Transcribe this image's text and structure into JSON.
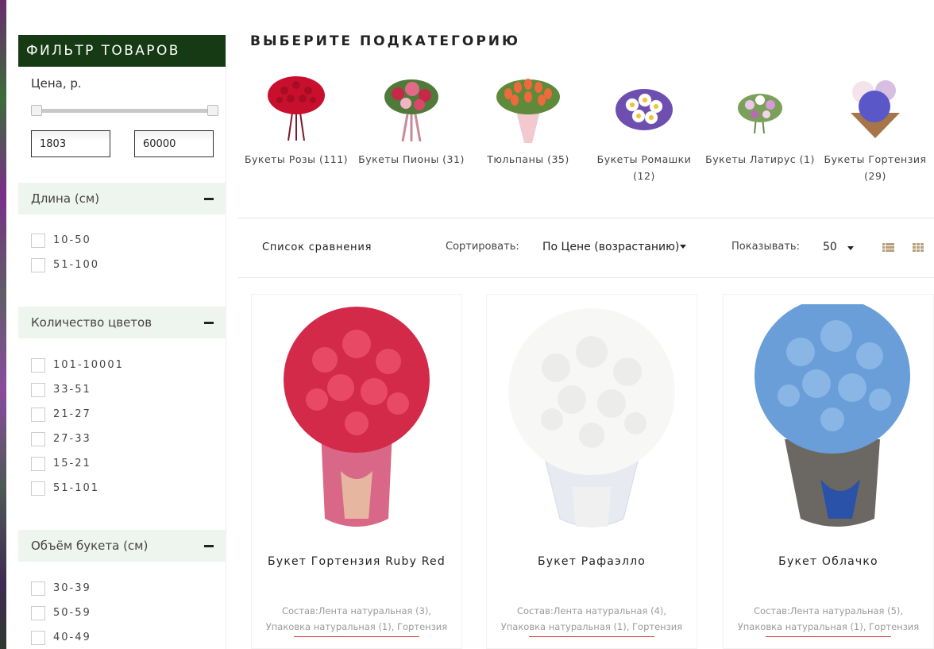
{
  "sidebar": {
    "title": "ФИЛЬТР ТОВАРОВ",
    "price": {
      "label": "Цена, р.",
      "min": "1803",
      "max": "60000",
      "range_min_fraction": 0,
      "range_max_fraction": 1
    },
    "groups": [
      {
        "title": "Длина (см)",
        "options": [
          "10-50",
          "51-100"
        ]
      },
      {
        "title": "Количество цветов",
        "options": [
          "101-10001",
          "33-51",
          "21-27",
          "27-33",
          "15-21",
          "51-101"
        ]
      },
      {
        "title": "Объём букета (см)",
        "options": [
          "30-39",
          "50-59",
          "40-49"
        ]
      }
    ]
  },
  "main": {
    "subcategory_title": "ВЫБЕРИТЕ ПОДКАТЕГОРИЮ",
    "subcategories": [
      {
        "label": "Букеты Розы (111)",
        "icon": "red-roses-bouquet"
      },
      {
        "label": "Букеты Пионы (31)",
        "icon": "peony-bouquet"
      },
      {
        "label": "Тюльпаны (35)",
        "icon": "tulip-bouquet"
      },
      {
        "label": "Букеты Ромашки (12)",
        "icon": "daisy-bouquet"
      },
      {
        "label": "Букеты Латирус (1)",
        "icon": "lathyrus-bouquet"
      },
      {
        "label": "Букеты Гортензия (29)",
        "icon": "hydrangea-bouquet"
      }
    ],
    "toolbar": {
      "compare_label": "Список сравнения",
      "sort_label": "Сортировать:",
      "sort_value": "По Цене (возрастанию)",
      "show_label": "Показывать:",
      "show_value": "50"
    },
    "products": [
      {
        "name": "Букет Гортензия Ruby Red",
        "composition": "Состав:Лента натуральная (3), Упаковка натуральная (1), Гортензия",
        "color": "#d42a4a",
        "wrap": "#e07a97"
      },
      {
        "name": "Букет Рафаэлло",
        "composition": "Состав:Лента натуральная (4), Упаковка натуральная (1), Гортензия",
        "color": "#f4f4f2",
        "wrap": "#e8eaf2"
      },
      {
        "name": "Букет Облачко",
        "composition": "Состав:Лента натуральная (5), Упаковка натуральная (1), Гортензия",
        "color": "#6a9ed8",
        "wrap": "#6b6763"
      }
    ]
  },
  "colors": {
    "sidebar_header": "#163a14",
    "filter_group_bg": "#eef4ee",
    "accent_line": "#d43b3b"
  }
}
